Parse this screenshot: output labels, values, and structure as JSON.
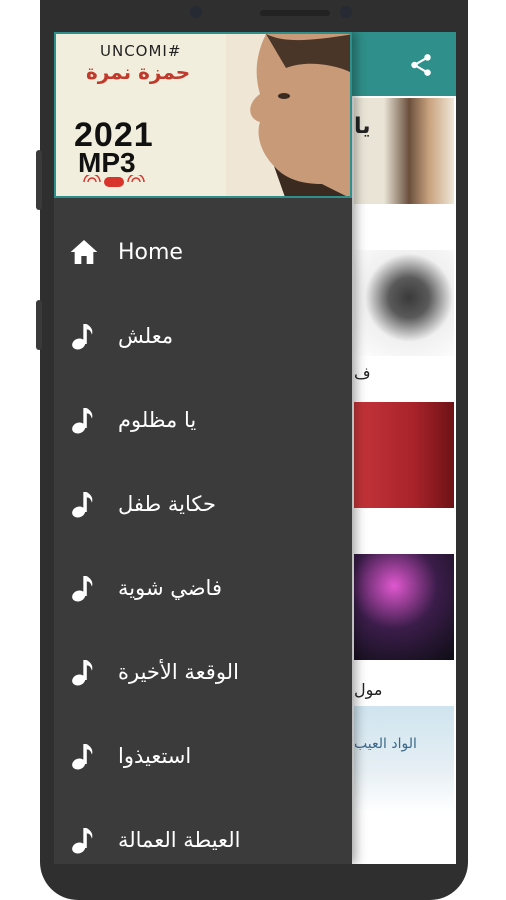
{
  "header": {
    "tag": "UNCOMI#",
    "artist": "حمزة نمرة",
    "year": "2021",
    "format": "MP3"
  },
  "menu": {
    "items": [
      {
        "label": "Home",
        "icon": "home-icon"
      },
      {
        "label": "معلش",
        "icon": "music-note-icon"
      },
      {
        "label": "يا مظلوم",
        "icon": "music-note-icon"
      },
      {
        "label": "حكاية طفل",
        "icon": "music-note-icon"
      },
      {
        "label": "فاضي شوية",
        "icon": "music-note-icon"
      },
      {
        "label": "الوقعة الأخيرة",
        "icon": "music-note-icon"
      },
      {
        "label": "استعيذوا",
        "icon": "music-note-icon"
      },
      {
        "label": "العيطة العمالة",
        "icon": "music-note-icon"
      }
    ]
  },
  "background": {
    "captions": [
      "يا",
      "ف",
      "مول",
      "الواد العيب"
    ]
  },
  "colors": {
    "appbar": "#2f8f8a",
    "drawer": "#3b3b3b",
    "phone": "#2f2f2f"
  }
}
